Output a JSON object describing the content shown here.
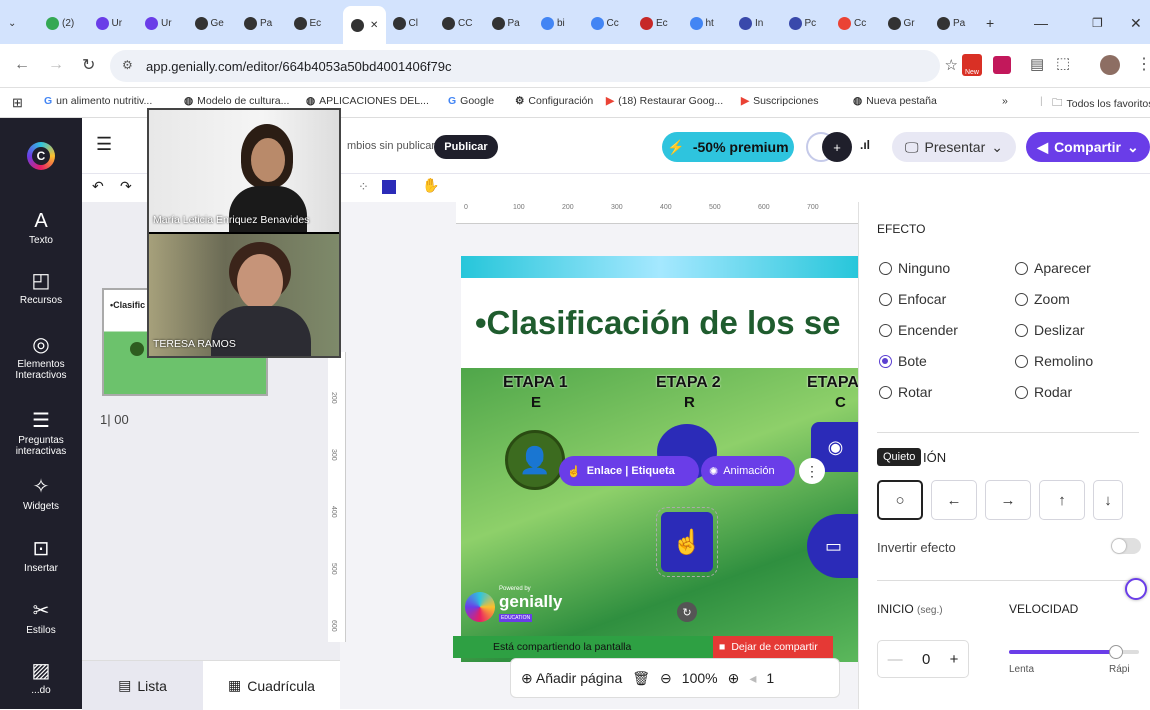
{
  "browser": {
    "tabs": [
      "(2)",
      "Ur",
      "Ur",
      "Ge",
      "Pa",
      "Ec",
      "",
      "Cl",
      "CC",
      "Pa",
      "bi",
      "Cc",
      "Ec",
      "ht",
      "In",
      "Pc",
      "Cc",
      "Gr",
      "Pa"
    ],
    "new_tab": "+",
    "url": "app.genially.com/editor/664b4053a50bd4001406f79c",
    "bookmarks": [
      "un alimento nutritiv...",
      "Modelo de cultura...",
      "APLICACIONES DEL...",
      "Google",
      "Configuración",
      "(18) Restaurar Goog...",
      "Suscripciones",
      "Nueva pestaña"
    ],
    "bookmarks_more": "»",
    "all_bookmarks": "Todos los favoritos",
    "new_badge": "New"
  },
  "sidebar": {
    "items": [
      {
        "icon": "text-icon",
        "glyph": "A",
        "label": "Texto"
      },
      {
        "icon": "resources-icon",
        "glyph": "◰",
        "label": "Recursos"
      },
      {
        "icon": "interactive-icon",
        "glyph": "◎",
        "label": "Elementos\nInteractivos"
      },
      {
        "icon": "questions-icon",
        "glyph": "☰",
        "label": "Preguntas\ninteractivas"
      },
      {
        "icon": "widgets-icon",
        "glyph": "✧",
        "label": "Widgets"
      },
      {
        "icon": "insert-icon",
        "glyph": "⊡",
        "label": "Insertar"
      },
      {
        "icon": "styles-icon",
        "glyph": "✂",
        "label": "Estilos"
      },
      {
        "icon": "background-icon",
        "glyph": "▨",
        "label": "...do"
      }
    ]
  },
  "header": {
    "unsaved": "mbios sin publicar",
    "publish": "Publicar",
    "premium": "-50% premium",
    "present": "Presentar",
    "share": "Compartir"
  },
  "webcam": {
    "person1": "María Leticia Enriquez Benavides",
    "person2": "TERESA RAMOS"
  },
  "pages_panel": {
    "thumb_title": "•Clasific",
    "page_number": "1| 00",
    "view_list": "Lista",
    "view_grid": "Cuadrícula"
  },
  "ruler": {
    "ticks": [
      "0",
      "100",
      "200",
      "300",
      "400",
      "500",
      "600",
      "700"
    ],
    "vticks": [
      "200",
      "300",
      "400",
      "500",
      "600"
    ]
  },
  "slide": {
    "title": "•Clasificación de los se",
    "stages": [
      {
        "title": "ETAPA 1",
        "letter": "E"
      },
      {
        "title": "ETAPA 2",
        "letter": "R"
      },
      {
        "title": "ETAPA",
        "letter": "C"
      }
    ],
    "floating_menu": "Enlace | Etiqueta",
    "animation_btn": "Animación",
    "powered": "Powered by",
    "brand": "genially",
    "edu": "EDUCATION"
  },
  "share_bar": {
    "sharing": "Está compartiendo la pantalla",
    "stop": "Dejar de compartir"
  },
  "bottom_bar": {
    "add_page": "Añadir página",
    "zoom": "100%",
    "page": "1"
  },
  "right_panel": {
    "effect_heading": "EFECTO",
    "effects_left": [
      "Ninguno",
      "Enfocar",
      "Encender",
      "Bote",
      "Rotar"
    ],
    "effects_right": [
      "Aparecer",
      "Zoom",
      "Deslizar",
      "Remolino",
      "Rodar"
    ],
    "selected": "Bote",
    "tooltip": "Quieto",
    "direction_heading": "IÓN",
    "directions": [
      "○",
      "←",
      "→",
      "↑",
      "↓"
    ],
    "invert": "Invertir efecto",
    "start_label": "INICIO",
    "start_unit": "(seg.)",
    "speed_label": "VELOCIDAD",
    "start_value": "0",
    "speed_slow": "Lenta",
    "speed_fast": "Rápi",
    "speed_value": 0.82
  },
  "colors": {
    "accent": "#5b3fd1",
    "premium": "#2ec4de",
    "share": "#6a3de8",
    "sidebar": "#1f1f2b"
  }
}
